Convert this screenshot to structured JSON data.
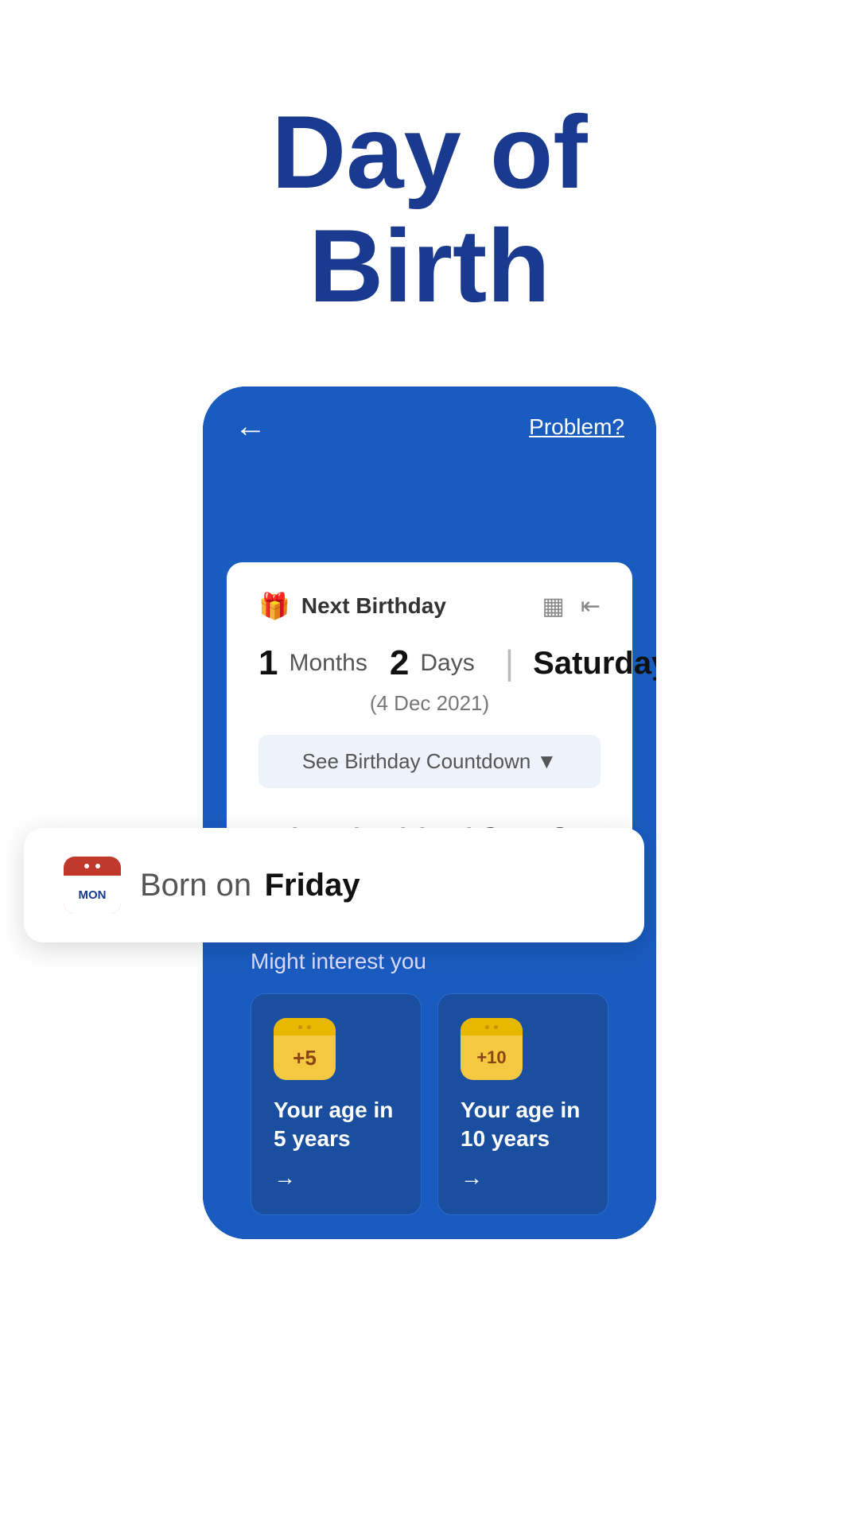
{
  "hero": {
    "title_line1": "Day of",
    "title_line2": "Birth"
  },
  "app_header": {
    "back_label": "←",
    "problem_label": "Problem?"
  },
  "born_card": {
    "prefix": "Born on",
    "day": "Friday"
  },
  "birthday_card": {
    "title": "Next Birthday",
    "months_num": "1",
    "months_label": "Months",
    "days_num": "2",
    "days_label": "Days",
    "day_name": "Saturday",
    "date_text": "(4  Dec  2021)",
    "see_countdown_label": "See Birthday Countdown ▼",
    "countdown": {
      "months": {
        "value": "1",
        "unit": "Months"
      },
      "days": {
        "value": "1",
        "unit": "Days"
      },
      "hours": {
        "value": "11",
        "unit": "Hours"
      },
      "minutes": {
        "value": "19",
        "unit": "Minutes"
      },
      "seconds": {
        "value": "6",
        "unit": "Seconds"
      }
    }
  },
  "interest_section": {
    "title": "Might interest you",
    "card1": {
      "badge": "+5",
      "text": "Your age in 5 years",
      "arrow": "→"
    },
    "card2": {
      "badge": "+10",
      "text": "Your age in 10 years",
      "arrow": "→"
    }
  },
  "colors": {
    "blue_dark": "#1a3a8f",
    "blue_mid": "#1a5bbf",
    "blue_card": "#1a4fa0",
    "white": "#ffffff",
    "yellow": "#f5c842"
  }
}
